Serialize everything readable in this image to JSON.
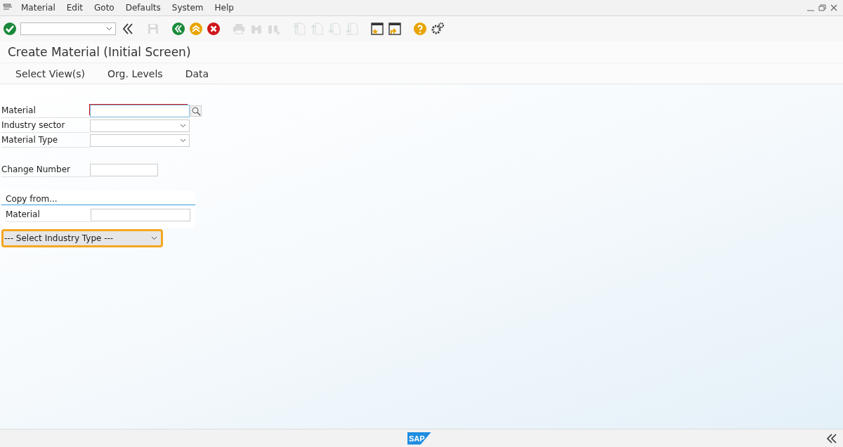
{
  "menu_bar": {
    "items": [
      "Material",
      "Edit",
      "Goto",
      "Defaults",
      "System",
      "Help"
    ]
  },
  "toolbar": {
    "buttons": [
      {
        "kind": "enter",
        "disabled": false
      },
      {
        "kind": "collapse",
        "disabled": false
      },
      {
        "kind": "save",
        "disabled": true
      },
      {
        "kind": "back",
        "disabled": false
      },
      {
        "kind": "exit",
        "disabled": false
      },
      {
        "kind": "cancel",
        "disabled": false
      },
      {
        "kind": "print",
        "disabled": true
      },
      {
        "kind": "find",
        "disabled": true
      },
      {
        "kind": "find-next",
        "disabled": true
      },
      {
        "kind": "first-page",
        "disabled": true
      },
      {
        "kind": "prev-page",
        "disabled": true
      },
      {
        "kind": "next-page",
        "disabled": true
      },
      {
        "kind": "last-page",
        "disabled": true
      },
      {
        "kind": "new-session",
        "disabled": false
      },
      {
        "kind": "shortcut",
        "disabled": false
      },
      {
        "kind": "help",
        "disabled": false
      },
      {
        "kind": "settings",
        "disabled": false
      }
    ]
  },
  "title": "Create Material (Initial Screen)",
  "app_toolbar": [
    "Select View(s)",
    "Org. Levels",
    "Data"
  ],
  "fields": [
    {
      "label": "Material",
      "kind": "search",
      "focused": true
    },
    {
      "label": "Industry sector",
      "kind": "dropdown",
      "focused": false
    },
    {
      "label": "Material Type",
      "kind": "dropdown",
      "focused": false
    },
    {
      "label": "Change Number",
      "kind": "short",
      "focused": false
    }
  ],
  "copy_from": {
    "title": "Copy from...",
    "fields": [
      {
        "label": "Material"
      }
    ]
  },
  "industry_select": {
    "value": "--- Select Industry Type ---",
    "highlighted": true
  },
  "footer": {
    "logo": "SAP"
  }
}
